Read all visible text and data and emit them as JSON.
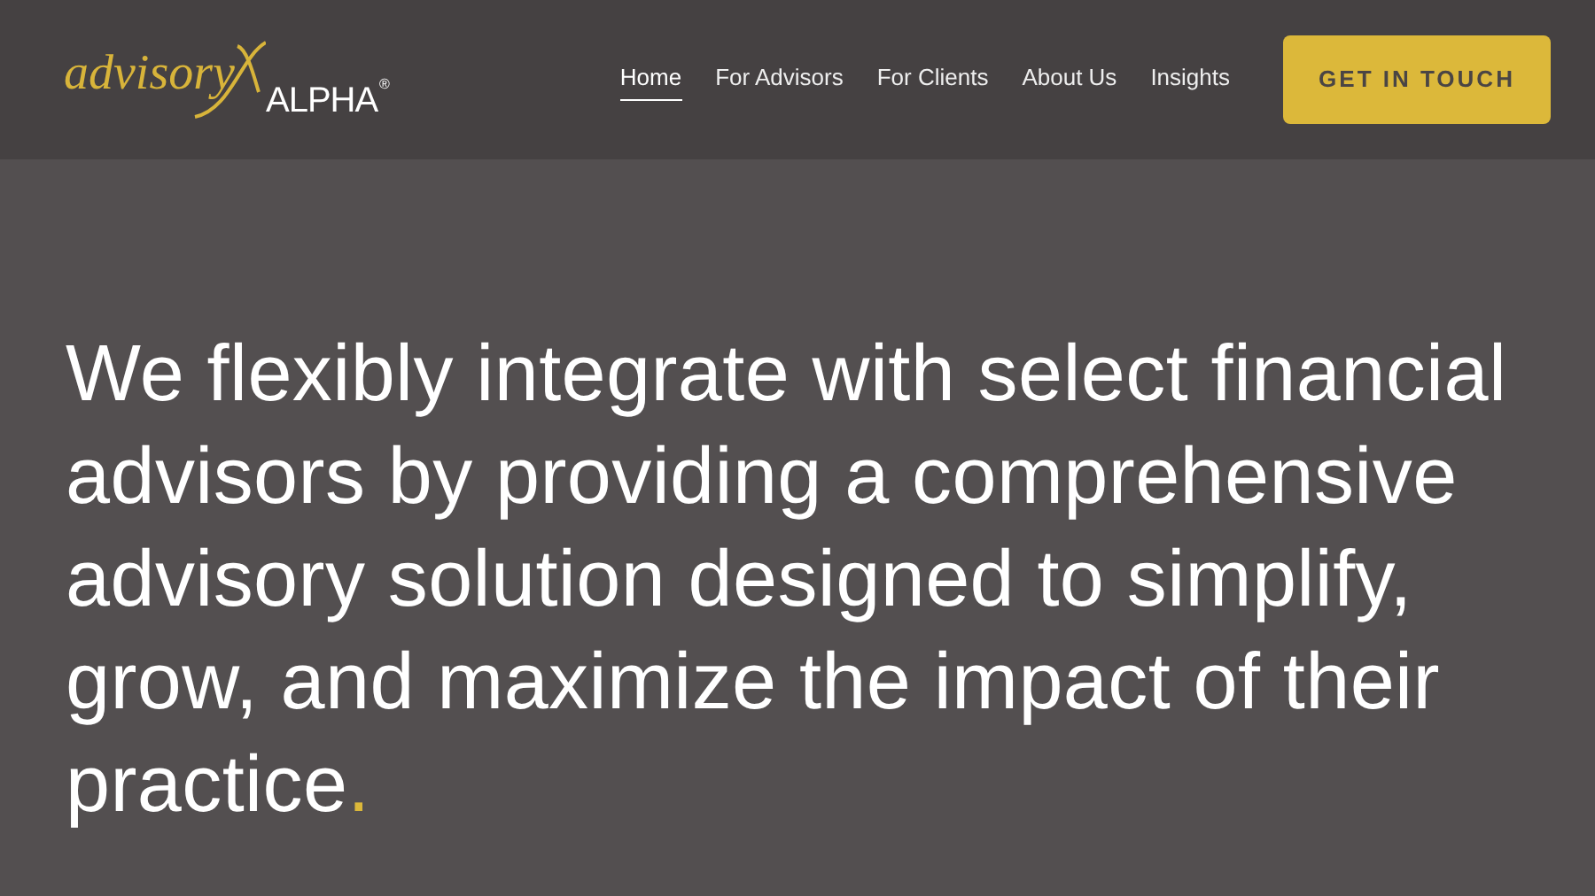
{
  "header": {
    "logo": {
      "script": "advisory",
      "word": "ALPHA",
      "mark": "®"
    },
    "nav": [
      {
        "label": "Home",
        "selected": true
      },
      {
        "label": "For Advisors",
        "selected": false
      },
      {
        "label": "For Clients",
        "selected": false
      },
      {
        "label": "About Us",
        "selected": false
      },
      {
        "label": "Insights",
        "selected": false
      }
    ],
    "cta": "GET IN TOUCH"
  },
  "hero": {
    "headline": "We flexibly integrate with select financial advisors by providing a comprehensive advisory solution designed to simplify, grow, and maximize the impact of their practice",
    "accent_end": "."
  }
}
